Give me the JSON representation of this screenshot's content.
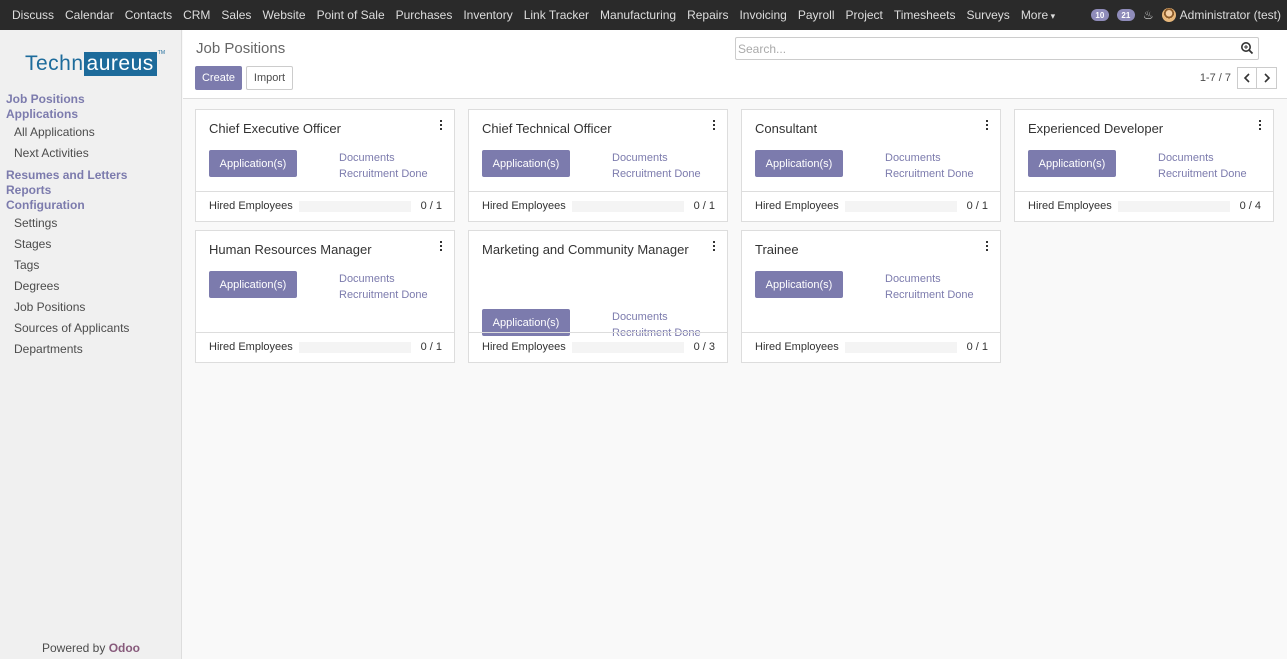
{
  "topbar": {
    "menu": [
      "Discuss",
      "Calendar",
      "Contacts",
      "CRM",
      "Sales",
      "Website",
      "Point of Sale",
      "Purchases",
      "Inventory",
      "Link Tracker",
      "Manufacturing",
      "Repairs",
      "Invoicing",
      "Payroll",
      "Project",
      "Timesheets",
      "Surveys"
    ],
    "more_label": "More",
    "messages_count": "10",
    "activities_count": "21",
    "user_name": "Administrator (test)"
  },
  "sidebar": {
    "logo_part1": "Techn",
    "logo_part2": "aureus",
    "logo_tm": "TM",
    "sections": [
      {
        "label": "Job Positions",
        "items": []
      },
      {
        "label": "Applications",
        "items": [
          "All Applications",
          "Next Activities"
        ]
      },
      {
        "label": "Resumes and Letters",
        "items": []
      },
      {
        "label": "Reports",
        "items": []
      },
      {
        "label": "Configuration",
        "items": [
          "Settings",
          "Stages",
          "Tags",
          "Degrees",
          "Job Positions",
          "Sources of Applicants",
          "Departments"
        ]
      }
    ],
    "powered_prefix": "Powered by",
    "powered_brand": "Odoo"
  },
  "control_panel": {
    "title": "Job Positions",
    "create_label": "Create",
    "import_label": "Import",
    "search_placeholder": "Search...",
    "pager_value": "1-7 / 7"
  },
  "kanban": {
    "app_button_label": "Application(s)",
    "link_documents": "Documents",
    "link_recruitment_done": "Recruitment Done",
    "footer_label": "Hired Employees",
    "cards": [
      {
        "title": "Chief Executive Officer",
        "hired": 0,
        "target": 1,
        "count": "0 / 1"
      },
      {
        "title": "Chief Technical Officer",
        "hired": 0,
        "target": 1,
        "count": "0 / 1"
      },
      {
        "title": "Consultant",
        "hired": 0,
        "target": 1,
        "count": "0 / 1"
      },
      {
        "title": "Experienced Developer",
        "hired": 0,
        "target": 4,
        "count": "0 / 4"
      },
      {
        "title": "Human Resources Manager",
        "hired": 0,
        "target": 1,
        "count": "0 / 1"
      },
      {
        "title": "Marketing and Community Manager",
        "hired": 0,
        "target": 3,
        "count": "0 / 3"
      },
      {
        "title": "Trainee",
        "hired": 0,
        "target": 1,
        "count": "0 / 1"
      }
    ]
  },
  "colors": {
    "topbar_bg": "#2a2a2a",
    "accent": "#7c7bad",
    "brand": "#875a7b",
    "logo_blue": "#1d6b9b"
  }
}
